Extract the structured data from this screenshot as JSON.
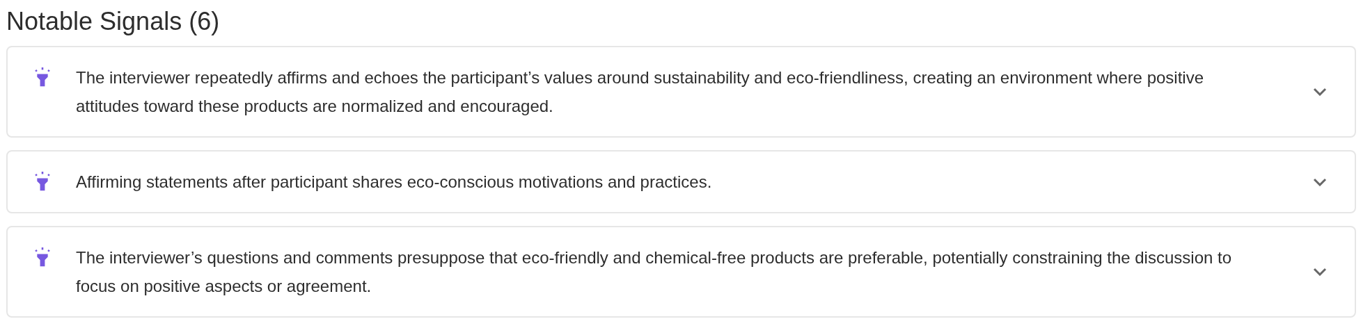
{
  "section": {
    "title": "Notable Signals (6)"
  },
  "signals": [
    {
      "text": "The interviewer repeatedly affirms and echoes the participant’s values around sustainability and eco-friendliness, creating an environment where positive attitudes toward these products are normalized and encouraged.",
      "expanded": false
    },
    {
      "text": "Affirming statements after participant shares eco-conscious motivations and practices.",
      "expanded": false
    },
    {
      "text": "The interviewer’s questions and comments presuppose that eco-friendly and chemical-free products are preferable, potentially constraining the discussion to focus on positive aspects or agreement.",
      "expanded": false
    }
  ]
}
